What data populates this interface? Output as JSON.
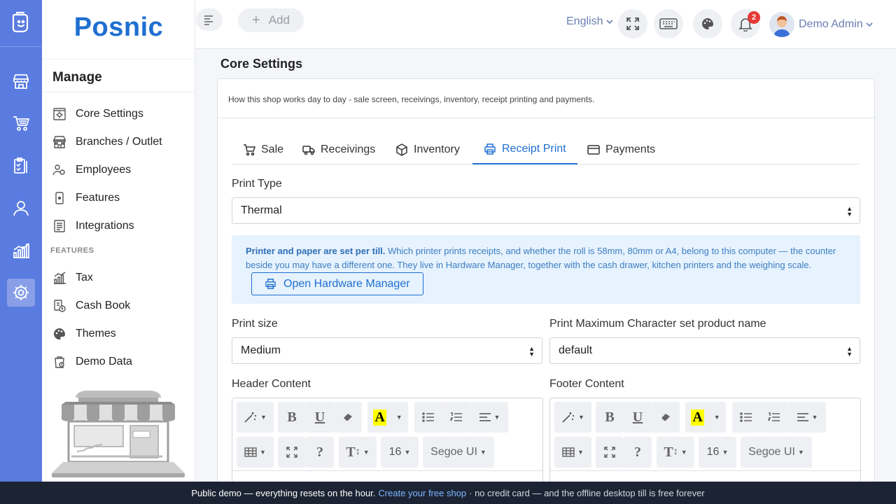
{
  "app": {
    "brand": "Posnic"
  },
  "rail": {
    "items": [
      "store",
      "cart",
      "clipboard",
      "user",
      "chart",
      "settings"
    ]
  },
  "sidebar": {
    "title": "Manage",
    "items": [
      {
        "label": "Core Settings",
        "icon": "settings-icon"
      },
      {
        "label": "Branches / Outlet",
        "icon": "store-icon"
      },
      {
        "label": "Employees",
        "icon": "employees-icon"
      },
      {
        "label": "Features",
        "icon": "phone-icon"
      },
      {
        "label": "Integrations",
        "icon": "list-icon"
      }
    ],
    "section_label": "FEATURES",
    "feature_items": [
      {
        "label": "Tax",
        "icon": "tax-chart-icon"
      },
      {
        "label": "Cash Book",
        "icon": "cash-book-icon"
      },
      {
        "label": "Themes",
        "icon": "palette-icon"
      },
      {
        "label": "Demo Data",
        "icon": "demo-data-icon"
      }
    ]
  },
  "topbar": {
    "add_label": "Add",
    "language": "English",
    "notification_count": "2",
    "user_name": "Demo Admin"
  },
  "page": {
    "title": "Core Settings",
    "description": "How this shop works day to day - sale screen, receivings, inventory, receipt printing and payments."
  },
  "tabs": [
    {
      "label": "Sale",
      "icon": "cart-icon"
    },
    {
      "label": "Receivings",
      "icon": "truck-icon"
    },
    {
      "label": "Inventory",
      "icon": "box-icon"
    },
    {
      "label": "Receipt Print",
      "icon": "printer-icon",
      "active": true
    },
    {
      "label": "Payments",
      "icon": "card-icon"
    }
  ],
  "form": {
    "print_type": {
      "label": "Print Type",
      "value": "Thermal"
    },
    "info": {
      "bold": "Printer and paper are set per till.",
      "text": " Which printer prints receipts, and whether the roll is 58mm, 80mm or A4, belong to this computer — the counter beside you may have a different one. They live in Hardware Manager, together with the cash drawer, kitchen printers and the weighing scale.",
      "button": "Open Hardware Manager"
    },
    "print_size": {
      "label": "Print size",
      "value": "Medium"
    },
    "max_charset": {
      "label": "Print Maximum Character set product name",
      "value": "default"
    },
    "header_content": {
      "label": "Header Content"
    },
    "footer_content": {
      "label": "Footer Content"
    }
  },
  "editor_toolbar": {
    "font_size": "16",
    "font_name": "Segoe UI"
  },
  "banner": {
    "prefix": "Public demo — everything resets on the hour.",
    "link": "Create your free shop",
    "suffix": "· no credit card — and the offline desktop till is free forever"
  },
  "colors": {
    "rail": "#5a7be0",
    "accent": "#1f6fd1",
    "info_bg": "#e6f2fd",
    "banner": "#1c2434"
  }
}
